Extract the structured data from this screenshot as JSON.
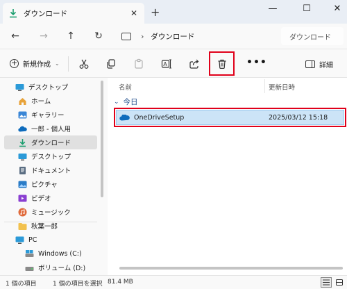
{
  "tab": {
    "title": "ダウンロード",
    "close_glyph": "✕",
    "new_tab_glyph": "+"
  },
  "window_controls": {
    "minimize": "—",
    "maximize": "☐",
    "close": "✕"
  },
  "address": {
    "breadcrumb": "ダウンロード",
    "chevron": "›",
    "search_placeholder": "ダウンロード"
  },
  "nav_buttons": {
    "back": "←",
    "forward": "→",
    "up": "↑",
    "refresh": "↻"
  },
  "toolbar": {
    "new_label": "新規作成",
    "new_caret": "⌄",
    "more": "•••",
    "details_label": "詳細"
  },
  "sidebar": {
    "items": [
      {
        "label": "デスクトップ",
        "icon": "desktop-icon"
      },
      {
        "label": "ホーム",
        "icon": "home-icon"
      },
      {
        "label": "ギャラリー",
        "icon": "gallery-icon"
      },
      {
        "label": "一郎 - 個人用",
        "icon": "onedrive-icon"
      },
      {
        "label": "ダウンロード",
        "icon": "download-icon",
        "selected": true
      },
      {
        "label": "デスクトップ",
        "icon": "desktop-icon"
      },
      {
        "label": "ドキュメント",
        "icon": "documents-icon"
      },
      {
        "label": "ピクチャ",
        "icon": "pictures-icon"
      },
      {
        "label": "ビデオ",
        "icon": "videos-icon"
      },
      {
        "label": "ミュージック",
        "icon": "music-icon"
      },
      {
        "label": "秋葉一郎",
        "icon": "folder-icon"
      },
      {
        "label": "PC",
        "icon": "pc-icon"
      },
      {
        "label": "Windows (C:)",
        "icon": "drive-icon"
      },
      {
        "label": "ボリューム (D:)",
        "icon": "drive-icon"
      }
    ]
  },
  "columns": {
    "name": "名前",
    "modified": "更新日時"
  },
  "group": {
    "label": "今日",
    "chevron": "⌄"
  },
  "files": [
    {
      "name": "OneDriveSetup",
      "modified": "2025/03/12 15:18",
      "icon": "onedrive-icon"
    }
  ],
  "status": {
    "item_count": "1 個の項目",
    "selection": "1 個の項目を選択",
    "size": "81.4 MB"
  },
  "colors": {
    "accent": "#0078d4",
    "selection": "#cce4f7",
    "highlight": "#e0001a"
  }
}
